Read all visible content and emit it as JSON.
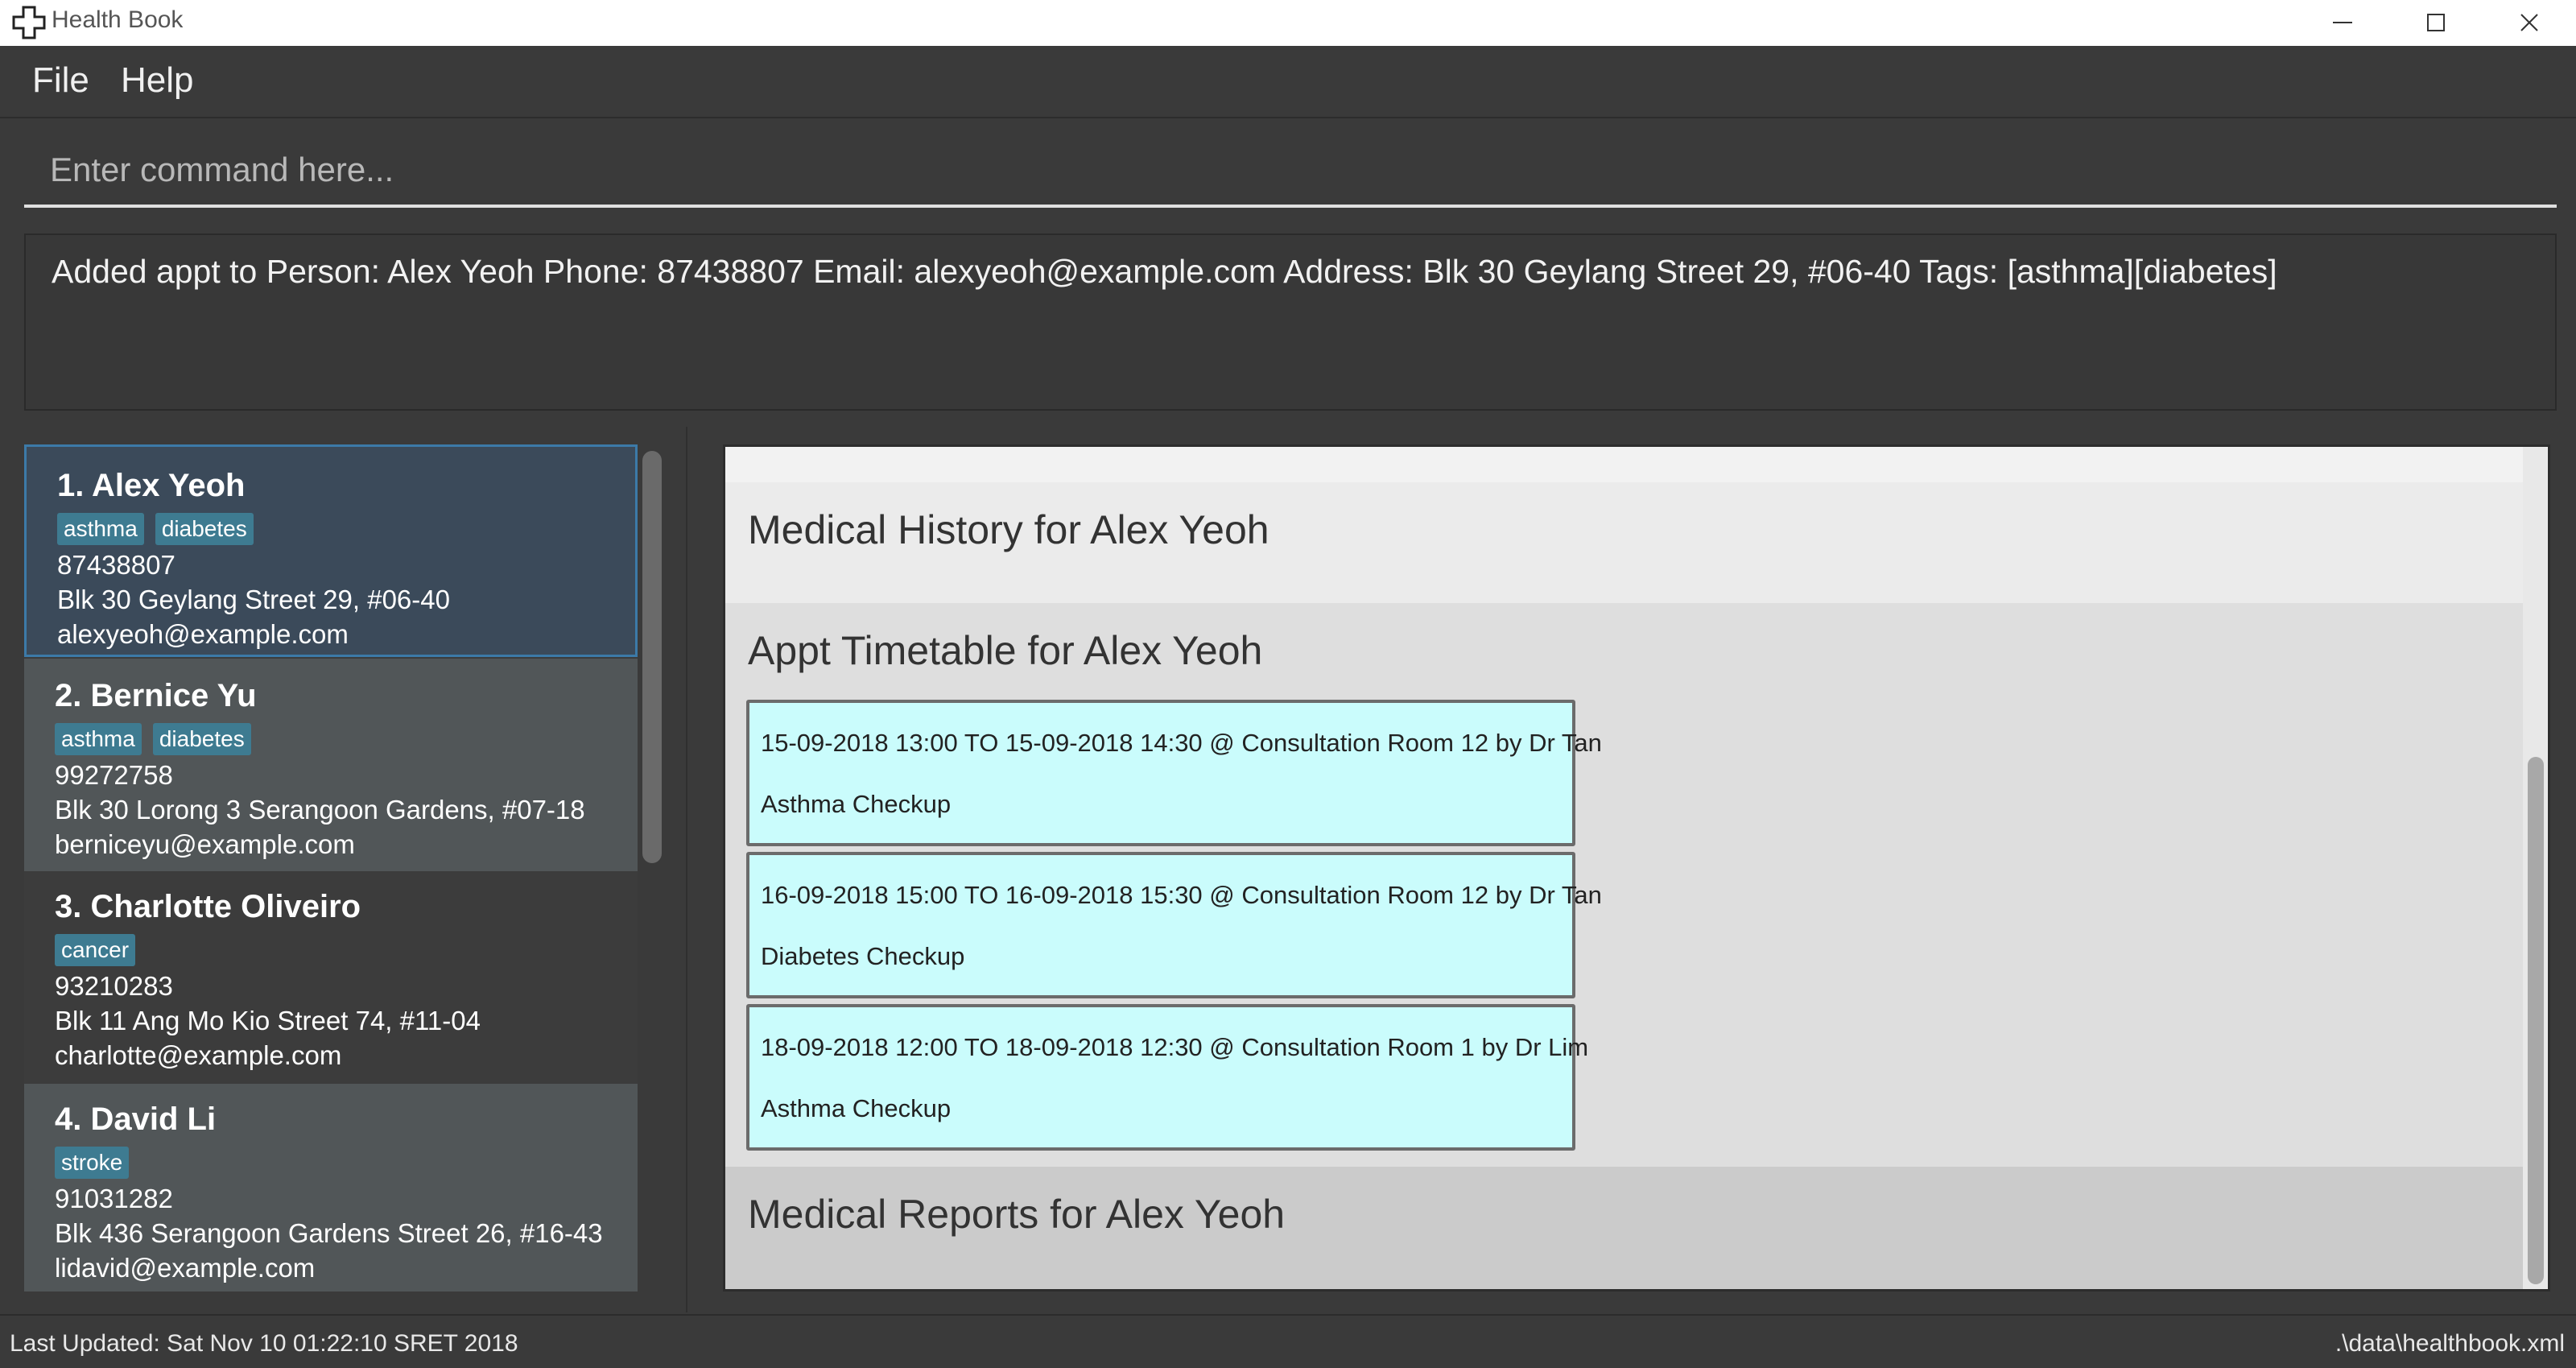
{
  "window": {
    "title": "Health Book",
    "icon": "health-cross-icon",
    "controls": [
      "minimize-icon",
      "maximize-icon",
      "close-icon"
    ]
  },
  "menu": {
    "file_label": "File",
    "help_label": "Help"
  },
  "command": {
    "placeholder": "Enter command here..."
  },
  "result": {
    "message": "Added appt to Person: Alex Yeoh Phone: 87438807 Email: alexyeoh@example.com Address: Blk 30 Geylang Street 29, #06-40 Tags: [asthma][diabetes]"
  },
  "persons": [
    {
      "index_name": "1.  Alex Yeoh",
      "tags": [
        "asthma",
        "diabetes"
      ],
      "phone": "87438807",
      "address": "Blk 30 Geylang Street 29, #06-40",
      "email": "alexyeoh@example.com",
      "selected": true
    },
    {
      "index_name": "2.  Bernice Yu",
      "tags": [
        "asthma",
        "diabetes"
      ],
      "phone": "99272758",
      "address": "Blk 30 Lorong 3 Serangoon Gardens, #07-18",
      "email": "berniceyu@example.com"
    },
    {
      "index_name": "3.  Charlotte Oliveiro",
      "tags": [
        "cancer"
      ],
      "phone": "93210283",
      "address": "Blk 11 Ang Mo Kio Street 74, #11-04",
      "email": "charlotte@example.com"
    },
    {
      "index_name": "4.  David Li",
      "tags": [
        "stroke"
      ],
      "phone": "91031282",
      "address": "Blk 436 Serangoon Gardens Street 26, #16-43",
      "email": "lidavid@example.com"
    }
  ],
  "details": {
    "medical_history_title": "Medical History for Alex Yeoh",
    "appt_timetable_title": "Appt Timetable for Alex Yeoh",
    "appointments": [
      {
        "when": "15-09-2018 13:00 TO 15-09-2018 14:30 @ Consultation Room 12 by Dr Tan",
        "desc": "Asthma Checkup"
      },
      {
        "when": "16-09-2018 15:00 TO 16-09-2018 15:30 @ Consultation Room 12 by Dr Tan",
        "desc": "Diabetes Checkup"
      },
      {
        "when": "18-09-2018 12:00 TO 18-09-2018 12:30 @ Consultation Room 1 by Dr Lim",
        "desc": "Asthma Checkup"
      }
    ],
    "medical_reports_title": "Medical Reports for Alex Yeoh"
  },
  "status": {
    "last_updated": "Last Updated: Sat Nov 10 01:22:10 SRET 2018",
    "file_path": ".\\data\\healthbook.xml"
  },
  "colors": {
    "background": "#3a3a3a",
    "selected_card": "#3b4a5a",
    "tag": "#3e7b91",
    "appointment": "#cafcfc"
  }
}
